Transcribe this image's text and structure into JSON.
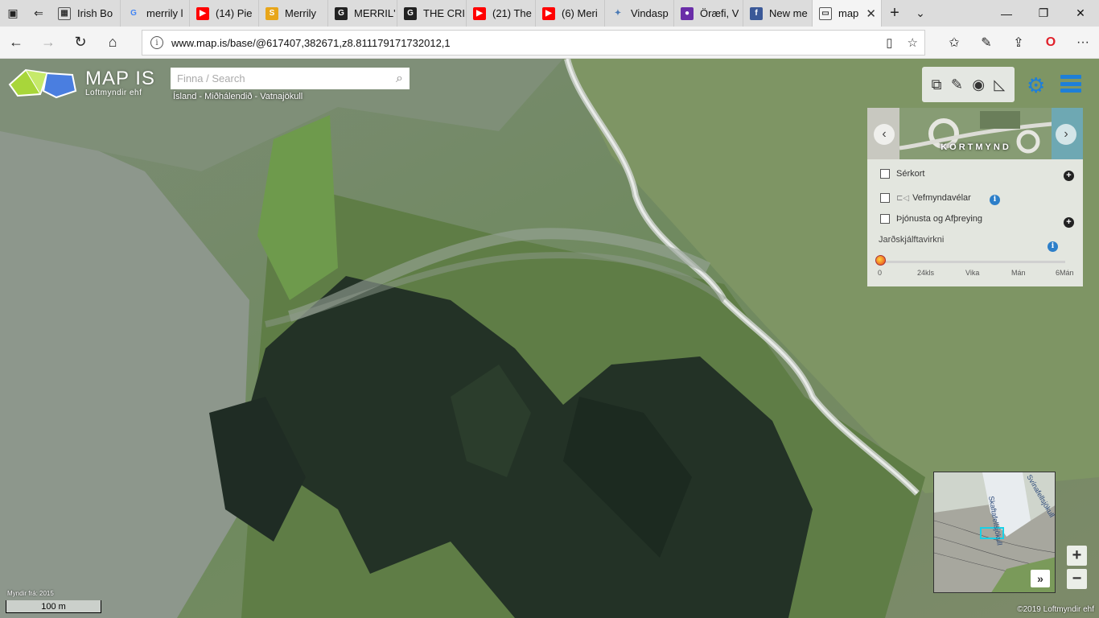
{
  "browser": {
    "tabs": [
      {
        "title": "Irish Bo",
        "favicon": "doc-icon",
        "color": "#ffffff"
      },
      {
        "title": "merrily l",
        "favicon": "google-icon",
        "color": "#4285f4"
      },
      {
        "title": "(14) Pie",
        "favicon": "youtube-icon",
        "color": "#ff0000"
      },
      {
        "title": "Merrily",
        "favicon": "s-icon",
        "color": "#e8a61a"
      },
      {
        "title": "MERRIL'",
        "favicon": "g-icon",
        "color": "#222222"
      },
      {
        "title": "THE CRI",
        "favicon": "g-icon",
        "color": "#222222"
      },
      {
        "title": "(21) The",
        "favicon": "youtube-icon",
        "color": "#ff0000"
      },
      {
        "title": "(6) Meri",
        "favicon": "youtube-icon",
        "color": "#ff0000"
      },
      {
        "title": "Vindasp",
        "favicon": "star-icon",
        "color": "#4a7ab5"
      },
      {
        "title": "Öræfi, V",
        "favicon": "circle-icon",
        "color": "#6a2da8"
      },
      {
        "title": "New me",
        "favicon": "facebook-icon",
        "color": "#3b5998"
      },
      {
        "title": "map",
        "favicon": "page-icon",
        "color": "#ffffff",
        "active": true
      }
    ],
    "url": "www.map.is/base/@617407,382671,z8.811179171732012,1"
  },
  "map": {
    "brand": "MAP IS",
    "brand_sub": "Loftmyndir ehf",
    "search_placeholder": "Finna / Search",
    "location": "Ísland - Miðhálendið - Vatnajökull",
    "carousel_caption": "KORTMYND",
    "layers": [
      {
        "label": "Sérkort",
        "checked": false
      },
      {
        "label": "Vefmyndavélar",
        "checked": false
      },
      {
        "label": "Þjónusta og Afþreying",
        "checked": false
      }
    ],
    "quake_title": "Jarðskjálftavirkni",
    "quake_ticks": [
      "0",
      "24kls",
      "Vika",
      "Mán",
      "6Mán"
    ],
    "image_year": "Myndir frá: 2015",
    "scale": "100 m",
    "copyright": "©2019 Loftmyndir ehf",
    "minimap_labels": [
      "Skaftafellsjökull",
      "Svínafellsjökull"
    ],
    "accent": "#1e7fd8"
  }
}
